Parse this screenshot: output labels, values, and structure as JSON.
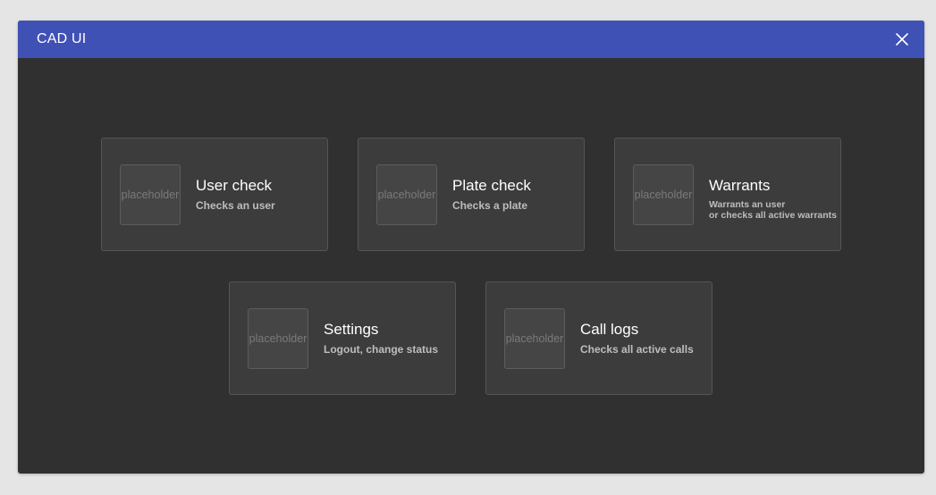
{
  "window": {
    "title": "CAD UI"
  },
  "colors": {
    "titlebar": "#3f51b5",
    "background": "#303030",
    "card": "#3c3c3c",
    "card_border": "#555555"
  },
  "cards": [
    {
      "title": "User check",
      "subtitle": "Checks an user",
      "thumb_text": "placeholder",
      "icon": "placeholder-image"
    },
    {
      "title": "Plate check",
      "subtitle": "Checks a plate",
      "thumb_text": "placeholder",
      "icon": "placeholder-image"
    },
    {
      "title": "Warrants",
      "subtitle": "Warrants an user\nor checks all active warrants",
      "thumb_text": "placeholder",
      "icon": "placeholder-image"
    },
    {
      "title": "Settings",
      "subtitle": "Logout, change status",
      "thumb_text": "placeholder",
      "icon": "placeholder-image"
    },
    {
      "title": "Call logs",
      "subtitle": "Checks all active calls",
      "thumb_text": "placeholder",
      "icon": "placeholder-image"
    }
  ],
  "icons": {
    "close": "close-icon"
  }
}
